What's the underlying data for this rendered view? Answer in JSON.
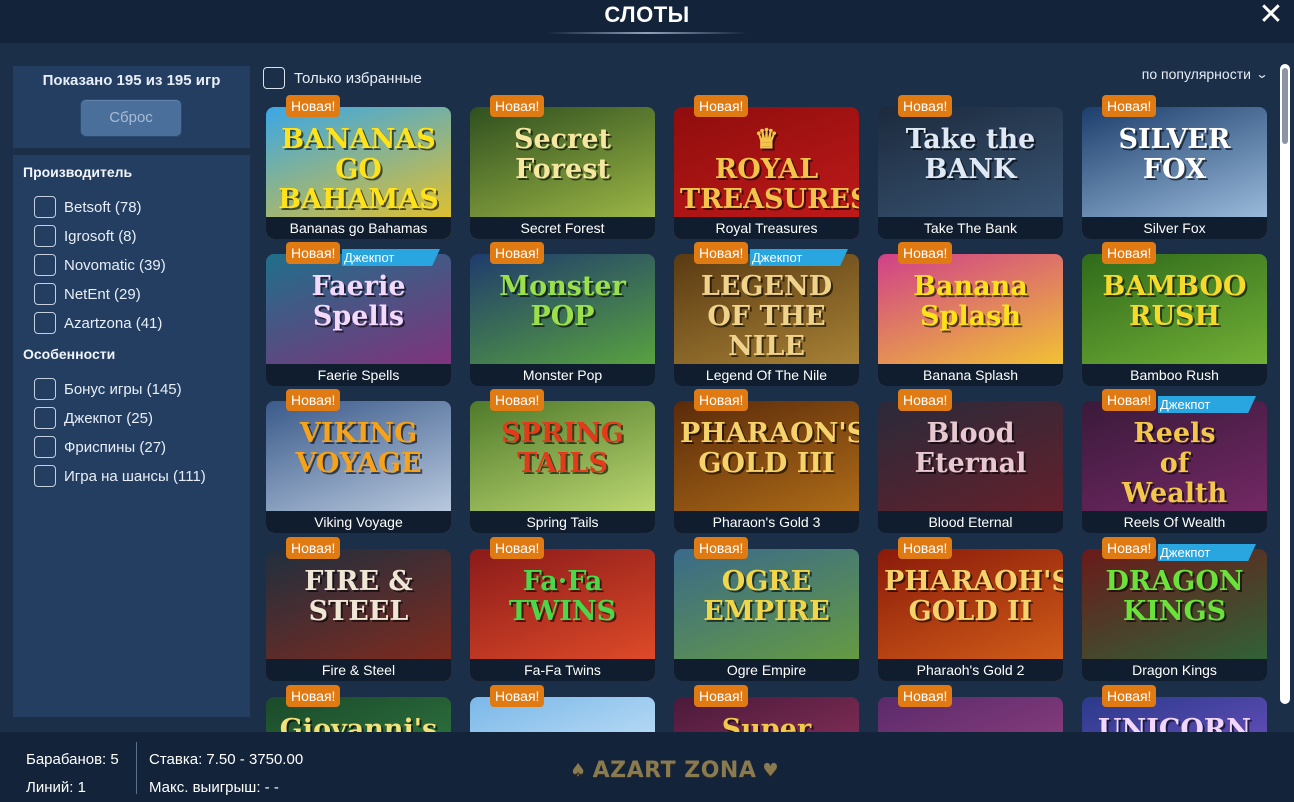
{
  "header": {
    "title": "СЛОТЫ",
    "close_icon": "close-icon"
  },
  "summary": {
    "shown_text": "Показано 195 из 195 игр",
    "reset_label": "Сброс"
  },
  "favorites": {
    "label": "Только избранные",
    "checked": false
  },
  "sort": {
    "label": "по популярности",
    "icon": "chevron-down-icon"
  },
  "filters": {
    "provider_title": "Производитель",
    "providers": [
      {
        "label": "Betsoft (78)"
      },
      {
        "label": "Igrosoft (8)"
      },
      {
        "label": "Novomatic (39)"
      },
      {
        "label": "NetEnt (29)"
      },
      {
        "label": "Azartzona (41)"
      }
    ],
    "features_title": "Особенности",
    "features": [
      {
        "label": "Бонус игры (145)"
      },
      {
        "label": "Джекпот (25)"
      },
      {
        "label": "Фриспины (27)"
      },
      {
        "label": "Игра на шансы (111)"
      }
    ]
  },
  "badges": {
    "new": "Новая!",
    "jackpot": "Джекпот"
  },
  "games": [
    {
      "name": "Bananas go Bahamas",
      "logo": "BANANAS\nGO\nBAHAMAS",
      "jackpot": false,
      "bg": "#3aa7e6",
      "bg2": "#f2c21b",
      "logo_color": "#ffe21a"
    },
    {
      "name": "Secret Forest",
      "logo": "Secret\nForest",
      "jackpot": false,
      "bg": "#2f4f1f",
      "bg2": "#a8c24a",
      "logo_color": "#f5e7a0"
    },
    {
      "name": "Royal Treasures",
      "logo": "♛\nROYAL TREASURES",
      "jackpot": false,
      "bg": "#8f0d0d",
      "bg2": "#c41b1b",
      "logo_color": "#f4c44a"
    },
    {
      "name": "Take The Bank",
      "logo": "Take the\nBANK",
      "jackpot": false,
      "bg": "#1c2a3d",
      "bg2": "#3d5a7a",
      "logo_color": "#dfe9f5"
    },
    {
      "name": "Silver Fox",
      "logo": "SILVER FOX",
      "jackpot": false,
      "bg": "#1c3e6b",
      "bg2": "#a9c9e8",
      "logo_color": "#ffffff"
    },
    {
      "name": "Faerie Spells",
      "logo": "Faerie Spells",
      "jackpot": true,
      "bg": "#1f6f8a",
      "bg2": "#8b2c7a",
      "logo_color": "#f3d9ff"
    },
    {
      "name": "Monster Pop",
      "logo": "Monster\nPOP",
      "jackpot": false,
      "bg": "#1f3b6d",
      "bg2": "#5fae3a",
      "logo_color": "#9be04a"
    },
    {
      "name": "Legend Of The Nile",
      "logo": "LEGEND OF THE NILE",
      "jackpot": true,
      "bg": "#5a3a12",
      "bg2": "#b08a3a",
      "logo_color": "#f0d38a"
    },
    {
      "name": "Banana Splash",
      "logo": "Banana Splash",
      "jackpot": false,
      "bg": "#d0408a",
      "bg2": "#f5d12a",
      "logo_color": "#ffe21a"
    },
    {
      "name": "Bamboo Rush",
      "logo": "BAMBOO\nRUSH",
      "jackpot": false,
      "bg": "#2f6a1a",
      "bg2": "#7ab83a",
      "logo_color": "#f7d92a"
    },
    {
      "name": "Viking Voyage",
      "logo": "VIKING\nVOYAGE",
      "jackpot": false,
      "bg": "#3a5a8a",
      "bg2": "#c8d6e8",
      "logo_color": "#f6a21a"
    },
    {
      "name": "Spring Tails",
      "logo": "SPRING\nTAILS",
      "jackpot": false,
      "bg": "#4f7a2a",
      "bg2": "#c9e27a",
      "logo_color": "#e23a1a"
    },
    {
      "name": "Pharaon's Gold 3",
      "logo": "PHARAON'S\nGOLD III",
      "jackpot": false,
      "bg": "#5a2a0a",
      "bg2": "#b8741a",
      "logo_color": "#f6d26a"
    },
    {
      "name": "Blood Eternal",
      "logo": "Blood Eternal",
      "jackpot": false,
      "bg": "#2a2a3a",
      "bg2": "#6a1f2a",
      "logo_color": "#e8c8d0"
    },
    {
      "name": "Reels Of Wealth",
      "logo": "Reels\nof\nWealth",
      "jackpot": true,
      "bg": "#3a1a3a",
      "bg2": "#7a2a6a",
      "logo_color": "#f3c84a"
    },
    {
      "name": "Fire & Steel",
      "logo": "FIRE & STEEL",
      "jackpot": false,
      "bg": "#1f2f3f",
      "bg2": "#8a2a1a",
      "logo_color": "#f0e6d6"
    },
    {
      "name": "Fa-Fa Twins",
      "logo": "Fa·Fa\nTWINS",
      "jackpot": false,
      "bg": "#8a1a1a",
      "bg2": "#e8502a",
      "logo_color": "#4ad84a"
    },
    {
      "name": "Ogre Empire",
      "logo": "OGRE EMPIRE",
      "jackpot": false,
      "bg": "#3a6a8a",
      "bg2": "#6aa03a",
      "logo_color": "#f2d64a"
    },
    {
      "name": "Pharaoh's Gold 2",
      "logo": "PHARAOH'S\nGOLD II",
      "jackpot": false,
      "bg": "#8a1a0a",
      "bg2": "#d8641a",
      "logo_color": "#f6d26a"
    },
    {
      "name": "Dragon Kings",
      "logo": "DRAGON\nKINGS",
      "jackpot": true,
      "bg": "#6a1a1a",
      "bg2": "#2a6a3a",
      "logo_color": "#6ae23a"
    },
    {
      "name": "",
      "logo": "Giovanni's Gems",
      "jackpot": false,
      "bg": "#1a4a2a",
      "bg2": "#3a8a4a",
      "logo_color": "#f2e07a"
    },
    {
      "name": "",
      "logo": "",
      "jackpot": false,
      "bg": "#7ab8e8",
      "bg2": "#e8f4ff",
      "logo_color": "#ffffff"
    },
    {
      "name": "",
      "logo": "Super",
      "jackpot": false,
      "bg": "#4a1a3a",
      "bg2": "#a83a6a",
      "logo_color": "#f2c84a"
    },
    {
      "name": "",
      "logo": "",
      "jackpot": false,
      "bg": "#5a2a6a",
      "bg2": "#a84a8a",
      "logo_color": "#ffffff"
    },
    {
      "name": "",
      "logo": "UNICORN",
      "jackpot": false,
      "bg": "#2a3a8a",
      "bg2": "#8a5ad8",
      "logo_color": "#f2d6ff"
    }
  ],
  "footer": {
    "reels": "Барабанов: 5",
    "lines": "Линий: 1",
    "bet": "Ставка: 7.50 - 3750.00",
    "max_win": "Макс. выигрыш: - -",
    "brand": "AZART ZONA"
  }
}
